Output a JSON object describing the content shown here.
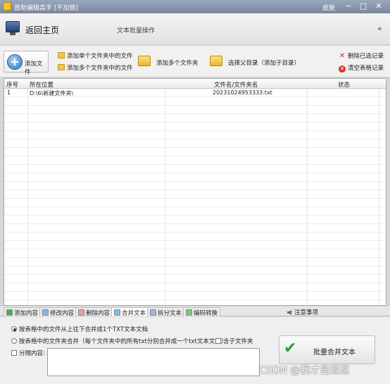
{
  "window": {
    "title": "首助编辑高手 [不加锁]",
    "skin_label": "皮肤",
    "minimize": "−",
    "maximize": "□",
    "close": "✕"
  },
  "header": {
    "home_label": "返回主页",
    "section_title": "文本批量操作",
    "collapse": "«"
  },
  "toolbar": {
    "add_file": "添加文件",
    "add_files_in_single_folder": "添加单个文件夹中的文件",
    "add_files_in_multiple_folders": "添加多个文件夹中的文件",
    "add_multiple_folders": "添加多个文件夹",
    "select_parent_dir": "选择父目录（添加子目录）",
    "delete_selected": "删除已选记录",
    "clear_table": "清空表格记录"
  },
  "table": {
    "columns": [
      "序号",
      "所在位置",
      "文件名/文件夹名",
      "状态"
    ],
    "rows": [
      {
        "index": "1",
        "location": "D:\\6\\新建文件夹\\",
        "name": "20231024953333.txt",
        "status": ""
      }
    ]
  },
  "tabs": {
    "items": [
      "添加内容",
      "修改内容",
      "删除内容",
      "合并文本",
      "拆分文本",
      "编码转换"
    ],
    "active": "合并文本",
    "notice": "注意事项"
  },
  "merge_options": {
    "option1": "按表格中的文件从上往下合并成1个TXT文本文档",
    "option2": "按表格中的文件夹合并（每个文件夹中的所有txt分别合并成一个txt文本文档）",
    "include_subfolders": "含子文件夹",
    "separator_label": "分隔内容:",
    "separator_value": "",
    "merge_button": "批量合并文本"
  },
  "watermark": "CSDN @我才是逗逗"
}
